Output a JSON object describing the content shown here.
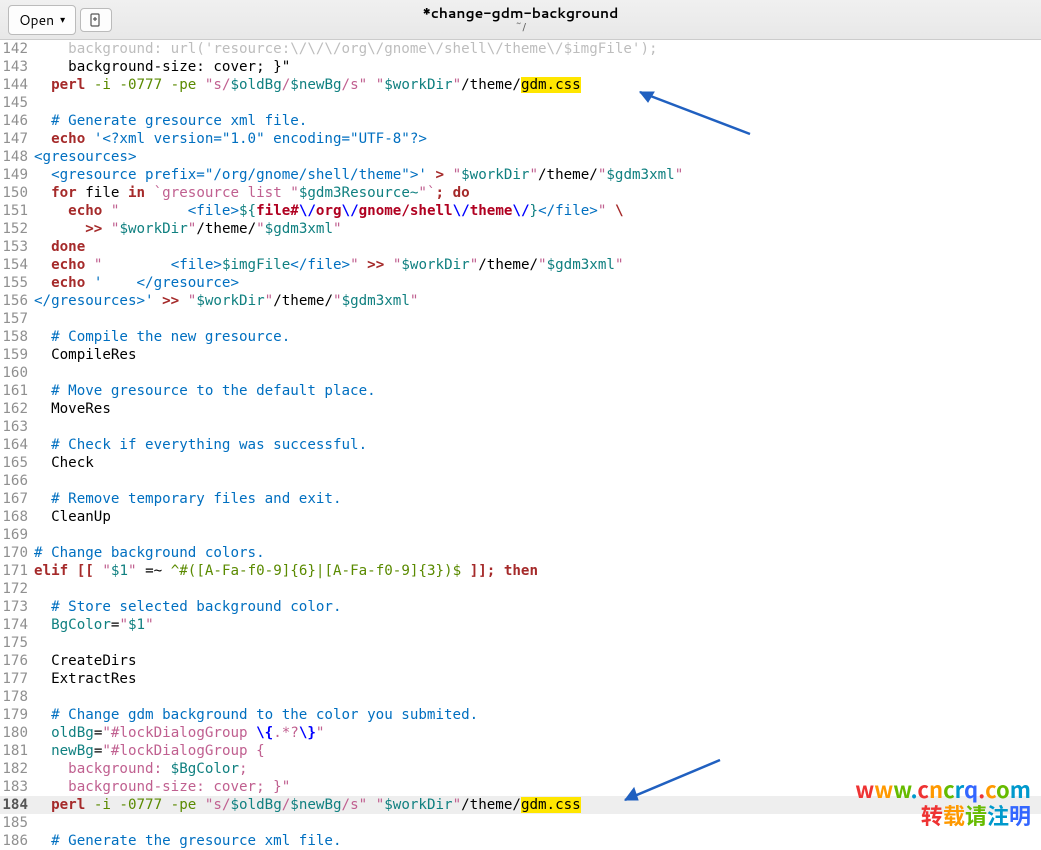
{
  "header": {
    "open_label": "Open",
    "title": "*change-gdm-background",
    "path": "~/"
  },
  "watermark": {
    "line1": "www.cncrq.com",
    "line2": "转载请注明"
  },
  "lines": [
    {
      "n": 142,
      "html": "    background: url('resource:\\/\\/\\/org\\/gnome\\/shell\\/theme\\/$imgFile');",
      "cls": "faded"
    },
    {
      "n": 143,
      "html": "    background-size: cover; }\""
    },
    {
      "n": 144,
      "html": "  <span class='kw'>perl</span> <span class='grn'>-i -0777 -pe</span> <span class='str'>\"s/</span><span class='var'>$oldBg</span><span class='str'>/</span><span class='var'>$newBg</span><span class='str'>/s\"</span> <span class='str'>\"</span><span class='var'>$workDir</span><span class='str'>\"</span>/theme/<span class='hl'>gdm.css</span>"
    },
    {
      "n": 145,
      "html": ""
    },
    {
      "n": 146,
      "html": "  <span class='cmt'># Generate gresource xml file.</span>"
    },
    {
      "n": 147,
      "html": "  <span class='kw'>echo</span> <span class='cmt'>'&lt;?xml version=\"1.0\" encoding=\"UTF-8\"?&gt;</span>"
    },
    {
      "n": 148,
      "html": "<span class='cmt'>&lt;gresources&gt;</span>"
    },
    {
      "n": 149,
      "html": "  <span class='cmt'>&lt;gresource prefix=\"/org/gnome/shell/theme\"&gt;'</span> <span class='op'>&gt;</span> <span class='str'>\"</span><span class='var'>$workDir</span><span class='str'>\"</span>/theme/<span class='str'>\"</span><span class='var'>$gdm3xml</span><span class='str'>\"</span>"
    },
    {
      "n": 150,
      "html": "  <span class='kw'>for</span> file <span class='kw'>in</span> <span class='str'>`gresource list \"</span><span class='var'>$gdm3Resource~</span><span class='str'>\"`</span><span class='op'>; do</span>"
    },
    {
      "n": 151,
      "html": "    <span class='kw'>echo</span> <span class='str'>\"        </span><span class='cmt'>&lt;file&gt;</span><span class='var'>${</span><span class='red'>file#</span><span class='esc'>\\/</span><span class='red'>org</span><span class='esc'>\\/</span><span class='red'>gnome/shell</span><span class='esc'>\\/</span><span class='red'>theme</span><span class='esc'>\\/</span><span class='var'>}</span><span class='cmt'>&lt;/file&gt;</span><span class='str'>\"</span> <span class='op'>\\</span>"
    },
    {
      "n": 152,
      "html": "      <span class='op'>&gt;&gt;</span> <span class='str'>\"</span><span class='var'>$workDir</span><span class='str'>\"</span>/theme/<span class='str'>\"</span><span class='var'>$gdm3xml</span><span class='str'>\"</span>"
    },
    {
      "n": 153,
      "html": "  <span class='kw'>done</span>"
    },
    {
      "n": 154,
      "html": "  <span class='kw'>echo</span> <span class='str'>\"        </span><span class='cmt'>&lt;file&gt;</span><span class='var'>$imgFile</span><span class='cmt'>&lt;/file&gt;</span><span class='str'>\"</span> <span class='op'>&gt;&gt;</span> <span class='str'>\"</span><span class='var'>$workDir</span><span class='str'>\"</span>/theme/<span class='str'>\"</span><span class='var'>$gdm3xml</span><span class='str'>\"</span>"
    },
    {
      "n": 155,
      "html": "  <span class='kw'>echo</span> <span class='cmt'>'    &lt;/gresource&gt;</span>"
    },
    {
      "n": 156,
      "html": "<span class='cmt'>&lt;/gresources&gt;'</span> <span class='op'>&gt;&gt;</span> <span class='str'>\"</span><span class='var'>$workDir</span><span class='str'>\"</span>/theme/<span class='str'>\"</span><span class='var'>$gdm3xml</span><span class='str'>\"</span>"
    },
    {
      "n": 157,
      "html": ""
    },
    {
      "n": 158,
      "html": "  <span class='cmt'># Compile the new gresource.</span>"
    },
    {
      "n": 159,
      "html": "  CompileRes"
    },
    {
      "n": 160,
      "html": ""
    },
    {
      "n": 161,
      "html": "  <span class='cmt'># Move gresource to the default place.</span>"
    },
    {
      "n": 162,
      "html": "  MoveRes"
    },
    {
      "n": 163,
      "html": ""
    },
    {
      "n": 164,
      "html": "  <span class='cmt'># Check if everything was successful.</span>"
    },
    {
      "n": 165,
      "html": "  Check"
    },
    {
      "n": 166,
      "html": ""
    },
    {
      "n": 167,
      "html": "  <span class='cmt'># Remove temporary files and exit.</span>"
    },
    {
      "n": 168,
      "html": "  CleanUp"
    },
    {
      "n": 169,
      "html": ""
    },
    {
      "n": 170,
      "html": "<span class='cmt'># Change background colors.</span>"
    },
    {
      "n": 171,
      "html": "<span class='kw'>elif</span> <span class='kw'>[[</span> <span class='str'>\"</span><span class='var'>$1</span><span class='str'>\"</span> =~ <span class='grn'>^#([A-Fa-f0-9]{6}|[A-Fa-f0-9]{3})$</span> <span class='kw'>]]; then</span>"
    },
    {
      "n": 172,
      "html": ""
    },
    {
      "n": 173,
      "html": "  <span class='cmt'># Store selected background color.</span>"
    },
    {
      "n": 174,
      "html": "  <span class='var'>BgColor</span>=<span class='str'>\"</span><span class='var'>$1</span><span class='str'>\"</span>"
    },
    {
      "n": 175,
      "html": ""
    },
    {
      "n": 176,
      "html": "  CreateDirs"
    },
    {
      "n": 177,
      "html": "  ExtractRes"
    },
    {
      "n": 178,
      "html": ""
    },
    {
      "n": 179,
      "html": "  <span class='cmt'># Change gdm background to the color you submited.</span>"
    },
    {
      "n": 180,
      "html": "  <span class='var'>oldBg</span>=<span class='str'>\"#lockDialogGroup </span><span class='esc'>\\{</span><span class='str'>.*?</span><span class='esc'>\\}</span><span class='str'>\"</span>"
    },
    {
      "n": 181,
      "html": "  <span class='var'>newBg</span>=<span class='str'>\"#lockDialogGroup {</span>"
    },
    {
      "n": 182,
      "html": "<span class='str'>    background: </span><span class='var'>$BgColor</span><span class='str'>;</span>"
    },
    {
      "n": 183,
      "html": "<span class='str'>    background-size: cover; }\"</span>"
    },
    {
      "n": 184,
      "html": "  <span class='kw'>perl</span> <span class='grn'>-i -0777 -pe</span> <span class='str'>\"s/</span><span class='var'>$oldBg</span><span class='str'>/</span><span class='var'>$newBg</span><span class='str'>/s\"</span> <span class='str'>\"</span><span class='var'>$workDir</span><span class='str'>\"</span>/theme/<span class='hl'>gdm.css</span>",
      "current": true
    },
    {
      "n": 185,
      "html": ""
    },
    {
      "n": 186,
      "html": "  <span class='cmt'># Generate the gresource xml file.</span>"
    }
  ]
}
